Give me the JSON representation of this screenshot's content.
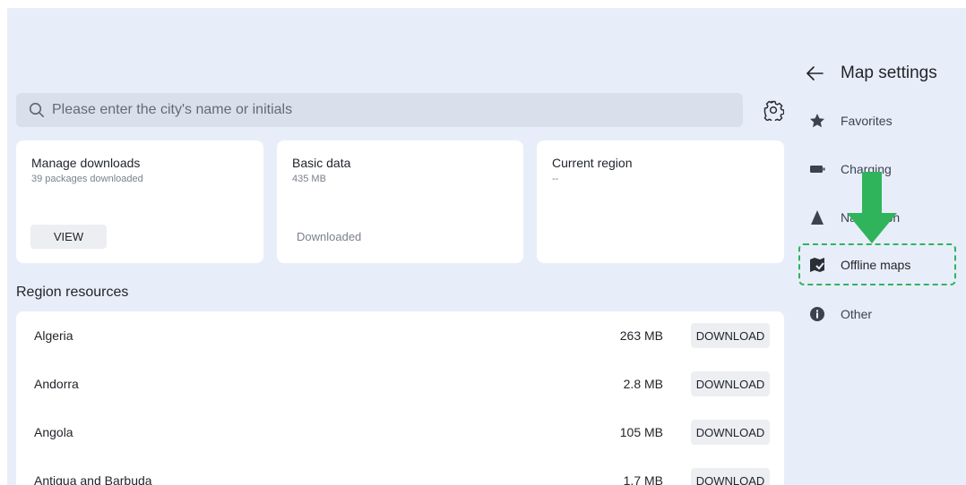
{
  "search": {
    "placeholder": "Please enter the city's name or initials"
  },
  "cards": {
    "manage": {
      "title": "Manage downloads",
      "subtitle": "39 packages downloaded",
      "button": "VIEW"
    },
    "basic": {
      "title": "Basic data",
      "subtitle": "435 MB",
      "status": "Downloaded"
    },
    "current": {
      "title": "Current region",
      "subtitle": "--"
    }
  },
  "region_section": {
    "title": "Region resources",
    "rows": [
      {
        "name": "Algeria",
        "size": "263 MB",
        "action": "DOWNLOAD"
      },
      {
        "name": "Andorra",
        "size": "2.8 MB",
        "action": "DOWNLOAD"
      },
      {
        "name": "Angola",
        "size": "105 MB",
        "action": "DOWNLOAD"
      },
      {
        "name": "Antigua and Barbuda",
        "size": "1.7 MB",
        "action": "DOWNLOAD"
      }
    ]
  },
  "settings_panel": {
    "title": "Map settings",
    "items": [
      {
        "label": "Favorites",
        "icon": "star-icon"
      },
      {
        "label": "Charging",
        "icon": "charging-icon"
      },
      {
        "label": "Navigation",
        "icon": "navigation-icon"
      },
      {
        "label": "Offline maps",
        "icon": "offline-maps-icon"
      },
      {
        "label": "Other",
        "icon": "info-icon"
      }
    ]
  },
  "colors": {
    "background": "#e8eef9",
    "card": "#ffffff",
    "search_bg": "#d9e0ec",
    "highlight": "#2fb45c",
    "arrow": "#2fb45c"
  }
}
